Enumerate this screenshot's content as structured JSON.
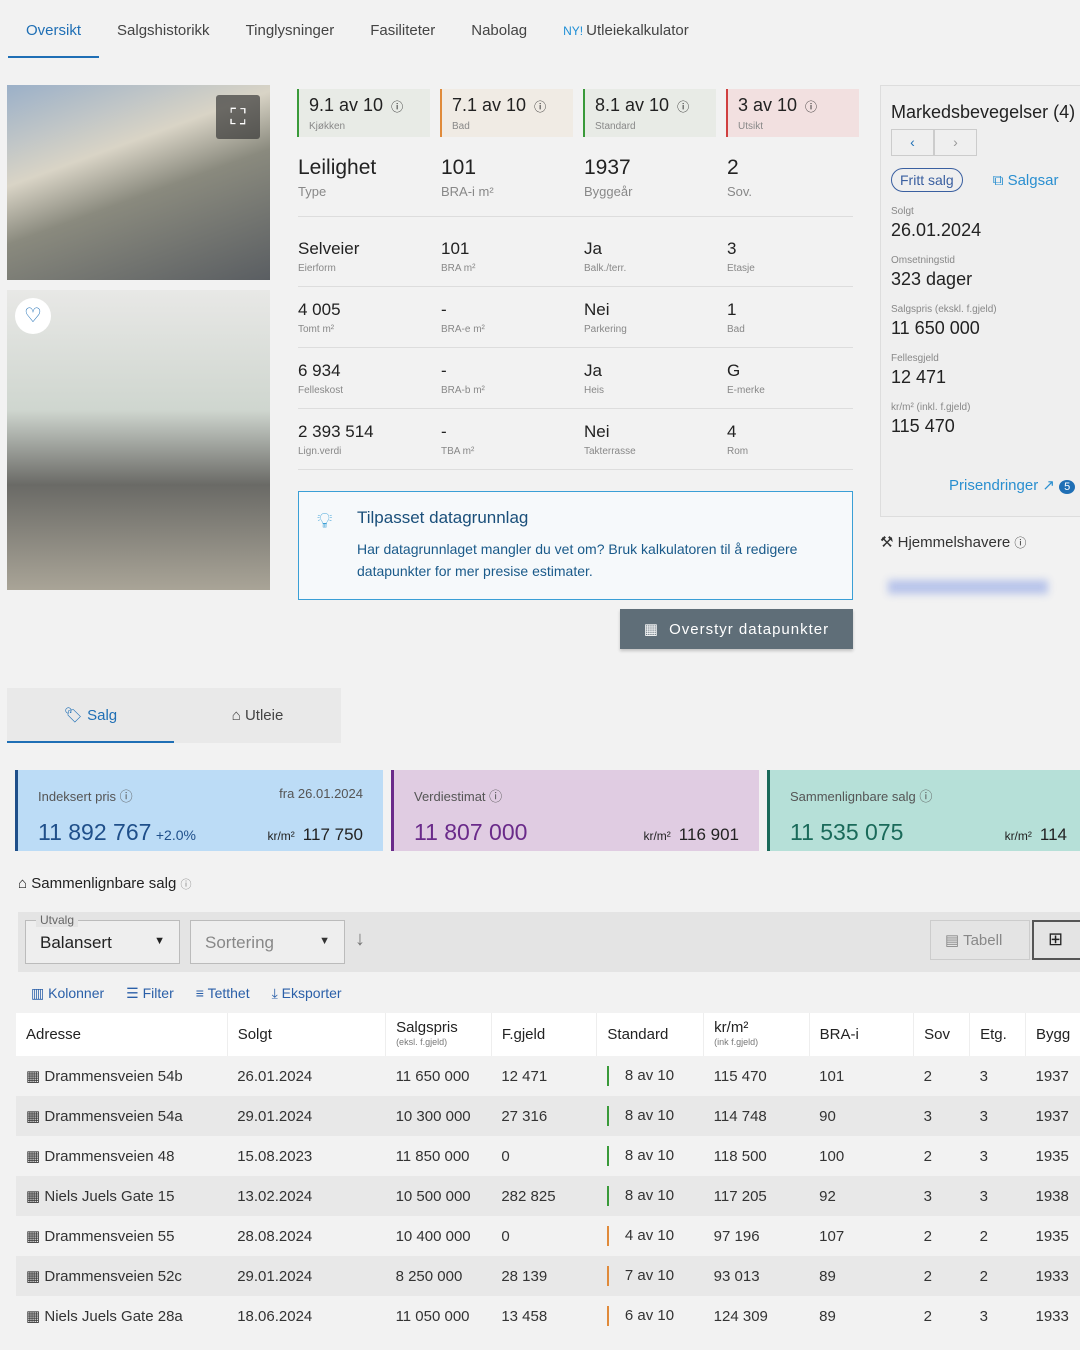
{
  "tabs": [
    {
      "label": "Oversikt"
    },
    {
      "label": "Salgshistorikk"
    },
    {
      "label": "Tinglysninger"
    },
    {
      "label": "Fasiliteter"
    },
    {
      "label": "Nabolag"
    },
    {
      "label": "Utleiekalkulator",
      "badge": "NY!"
    }
  ],
  "ratings": [
    {
      "value": "9.1 av 10",
      "label": "Kjøkken",
      "color": "#3a9a3a",
      "bg": "#e8ebe6"
    },
    {
      "value": "7.1 av 10",
      "label": "Bad",
      "color": "#e08a3a",
      "bg": "#f0ebe4"
    },
    {
      "value": "8.1 av 10",
      "label": "Standard",
      "color": "#3a9a3a",
      "bg": "#e8ebe6"
    },
    {
      "value": "3 av 10",
      "label": "Utsikt",
      "color": "#d04040",
      "bg": "#f2e0e0"
    }
  ],
  "main_facts": [
    {
      "value": "Leilighet",
      "label": "Type"
    },
    {
      "value": "101",
      "label": "BRA-i m²"
    },
    {
      "value": "1937",
      "label": "Byggeår"
    },
    {
      "value": "2",
      "label": "Sov."
    }
  ],
  "facts": [
    [
      {
        "value": "Selveier",
        "label": "Eierform"
      },
      {
        "value": "101",
        "label": "BRA m²"
      },
      {
        "value": "Ja",
        "label": "Balk./terr."
      },
      {
        "value": "3",
        "label": "Etasje"
      }
    ],
    [
      {
        "value": "4 005",
        "label": "Tomt m²"
      },
      {
        "value": "-",
        "label": "BRA-e m²"
      },
      {
        "value": "Nei",
        "label": "Parkering"
      },
      {
        "value": "1",
        "label": "Bad"
      }
    ],
    [
      {
        "value": "6 934",
        "label": "Felleskost"
      },
      {
        "value": "-",
        "label": "BRA-b m²"
      },
      {
        "value": "Ja",
        "label": "Heis"
      },
      {
        "value": "G",
        "label": "E-merke"
      }
    ],
    [
      {
        "value": "2 393 514",
        "label": "Lign.verdi"
      },
      {
        "value": "-",
        "label": "TBA m²"
      },
      {
        "value": "Nei",
        "label": "Takterrasse"
      },
      {
        "value": "4",
        "label": "Rom"
      }
    ]
  ],
  "info": {
    "title": "Tilpasset datagrunnlag",
    "text": "Har datagrunnlaget mangler du vet om? Bruk kalkulatoren til å redigere datapunkter for mer presise estimater."
  },
  "override_button": "Overstyr datapunkter",
  "market": {
    "title": "Markedsbevegelser (4)",
    "chip": "Fritt salg",
    "link": "Salgsar",
    "items": [
      {
        "label": "Solgt",
        "value": "26.01.2024"
      },
      {
        "label": "Omsetningstid",
        "value": "323 dager"
      },
      {
        "label": "Salgspris (ekskl. f.gjeld)",
        "value": "11 650 000"
      },
      {
        "label": "Fellesgjeld",
        "value": "12 471"
      },
      {
        "label": "kr/m² (inkl. f.gjeld)",
        "value": "115 470"
      }
    ],
    "price_changes": "Prisendringer",
    "badge": "5"
  },
  "owners": "Hjemmelshavere",
  "sub_tabs": [
    {
      "label": "Salg"
    },
    {
      "label": "Utleie"
    }
  ],
  "cards": [
    {
      "title": "Indeksert pris",
      "from": "fra 26.01.2024",
      "value": "11 892 767",
      "change": "+2.0%",
      "unit": "kr/m²",
      "per_m2": "117 750",
      "color": "#1f4f8a",
      "bg": "#bcdcf6"
    },
    {
      "title": "Verdiestimat",
      "value": "11 807 000",
      "unit": "kr/m²",
      "per_m2": "116 901",
      "color": "#6a2a8a",
      "bg": "#e0cce2"
    },
    {
      "title": "Sammenlignbare salg",
      "value": "11 535 075",
      "unit": "kr/m²",
      "per_m2": "114",
      "color": "#1a6a5a",
      "bg": "#b6e0d8"
    }
  ],
  "comparable": {
    "title": "Sammenlignbare salg",
    "utvalg_label": "Utvalg",
    "utvalg": "Balansert",
    "sort": "Sortering",
    "view_table": "Tabell",
    "toolbar": [
      "Kolonner",
      "Filter",
      "Tetthet",
      "Eksporter"
    ]
  },
  "table": {
    "headers": [
      {
        "t": "Adresse"
      },
      {
        "t": "Solgt"
      },
      {
        "t": "Salgspris",
        "s": "(eksl. f.gjeld)"
      },
      {
        "t": "F.gjeld"
      },
      {
        "t": "Standard"
      },
      {
        "t": "kr/m²",
        "s": "(ink f.gjeld)"
      },
      {
        "t": "BRA-i"
      },
      {
        "t": "Sov"
      },
      {
        "t": "Etg."
      },
      {
        "t": "Bygg"
      }
    ],
    "rows": [
      [
        "Drammensveien 54b",
        "26.01.2024",
        "11 650 000",
        "12 471",
        "8 av 10",
        "115 470",
        "101",
        "2",
        "3",
        "1937"
      ],
      [
        "Drammensveien 54a",
        "29.01.2024",
        "10 300 000",
        "27 316",
        "8 av 10",
        "114 748",
        "90",
        "3",
        "3",
        "1937"
      ],
      [
        "Drammensveien 48",
        "15.08.2023",
        "11 850 000",
        "0",
        "8 av 10",
        "118 500",
        "100",
        "2",
        "3",
        "1935"
      ],
      [
        "Niels Juels Gate 15",
        "13.02.2024",
        "10 500 000",
        "282 825",
        "8 av 10",
        "117 205",
        "92",
        "3",
        "3",
        "1938"
      ],
      [
        "Drammensveien 55",
        "28.08.2024",
        "10 400 000",
        "0",
        "4 av 10",
        "97 196",
        "107",
        "2",
        "2",
        "1935"
      ],
      [
        "Drammensveien 52c",
        "29.01.2024",
        "8 250 000",
        "28 139",
        "7 av 10",
        "93 013",
        "89",
        "2",
        "2",
        "1933"
      ],
      [
        "Niels Juels Gate 28a",
        "18.06.2024",
        "11 050 000",
        "13 458",
        "6 av 10",
        "124 309",
        "89",
        "2",
        "3",
        "1933"
      ]
    ],
    "standard_colors": [
      "#3a9a3a",
      "#3a9a3a",
      "#3a9a3a",
      "#3a9a3a",
      "#e08a3a",
      "#e08a3a",
      "#e08a3a"
    ]
  }
}
